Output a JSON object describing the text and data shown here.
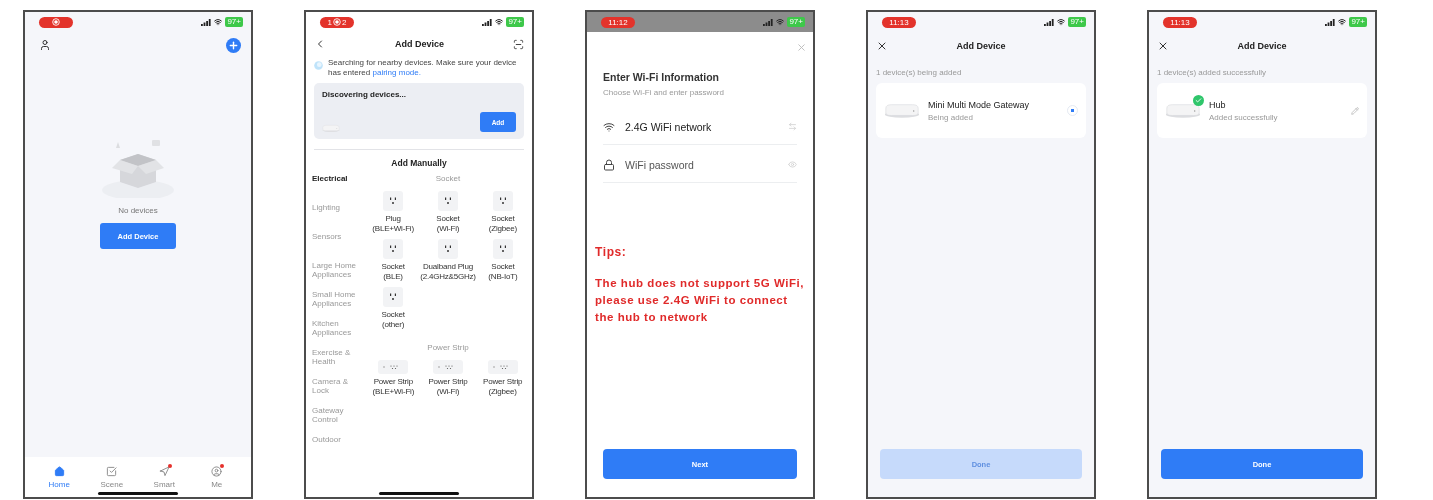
{
  "screens": [
    {
      "kind": "home",
      "status": {
        "recording": true,
        "battery": "97+"
      },
      "empty_text": "No devices",
      "button": "Add Device",
      "tabs": [
        {
          "label": "Home",
          "selected": true,
          "badge": false
        },
        {
          "label": "Scene",
          "selected": false,
          "badge": false
        },
        {
          "label": "Smart",
          "selected": false,
          "badge": true
        },
        {
          "label": "Me",
          "selected": false,
          "badge": true
        }
      ]
    },
    {
      "kind": "add_device",
      "status": {
        "recording": true,
        "texts": [
          "1",
          "2"
        ],
        "battery": "97+"
      },
      "title": "Add Device",
      "notice": "Searching for nearby devices. Make sure your device has entered",
      "notice_link": "pairing mode.",
      "discover_title": "Discovering devices...",
      "add_button": "Add",
      "manual_title": "Add Manually",
      "categories": [
        {
          "label": "Electrical",
          "selected": true
        },
        {
          "label": "Lighting",
          "selected": false
        },
        {
          "label": "Sensors",
          "selected": false
        },
        {
          "label": "Large Home Appliances",
          "selected": false
        },
        {
          "label": "Small Home Appliances",
          "selected": false
        },
        {
          "label": "Kitchen Appliances",
          "selected": false
        },
        {
          "label": "Exercise & Health",
          "selected": false
        },
        {
          "label": "Camera & Lock",
          "selected": false
        },
        {
          "label": "Gateway Control",
          "selected": false
        },
        {
          "label": "Outdoor",
          "selected": false
        }
      ],
      "groups": [
        {
          "title": "Socket",
          "kind": "socket",
          "items": [
            {
              "name": "Plug",
              "sub": "(BLE+Wi-Fi)"
            },
            {
              "name": "Socket",
              "sub": "(Wi-Fi)"
            },
            {
              "name": "Socket",
              "sub": "(Zigbee)"
            },
            {
              "name": "Socket",
              "sub": "(BLE)"
            },
            {
              "name": "Dualband Plug",
              "sub": "(2.4GHz&5GHz)"
            },
            {
              "name": "Socket",
              "sub": "(NB-IoT)"
            },
            {
              "name": "Socket",
              "sub": "(other)"
            }
          ]
        },
        {
          "title": "Power Strip",
          "kind": "strip",
          "items": [
            {
              "name": "Power Strip",
              "sub": "(BLE+Wi-Fi)"
            },
            {
              "name": "Power Strip",
              "sub": "(Wi-Fi)"
            },
            {
              "name": "Power Strip",
              "sub": "(Zigbee)"
            }
          ]
        }
      ]
    },
    {
      "kind": "wifi",
      "status": {
        "time": "11:12",
        "battery": "97+"
      },
      "title": "Enter Wi-Fi Information",
      "subtitle": "Choose Wi-Fi and enter password",
      "fields": [
        {
          "kind": "network",
          "value": "2.4G WiFi network"
        },
        {
          "kind": "password",
          "placeholder": "WiFi password"
        }
      ],
      "tips_title": "Tips:",
      "tips": "The hub does not support 5G WiFi, please use 2.4G WiFi to connect the hub to network",
      "button": "Next"
    },
    {
      "kind": "progress",
      "status": {
        "time": "11:13",
        "battery": "97+"
      },
      "title": "Add Device",
      "caption": "1 device(s) being added",
      "device": {
        "name": "Mini Multi Mode Gateway",
        "status": "Being added",
        "added": false
      },
      "done": {
        "label": "Done",
        "disabled": true
      }
    },
    {
      "kind": "progress",
      "status": {
        "time": "11:13",
        "battery": "97+"
      },
      "title": "Add Device",
      "caption": "1 device(s) added successfully",
      "device": {
        "name": "Hub",
        "status": "Added successfully",
        "added": true
      },
      "done": {
        "label": "Done",
        "disabled": false
      }
    }
  ]
}
